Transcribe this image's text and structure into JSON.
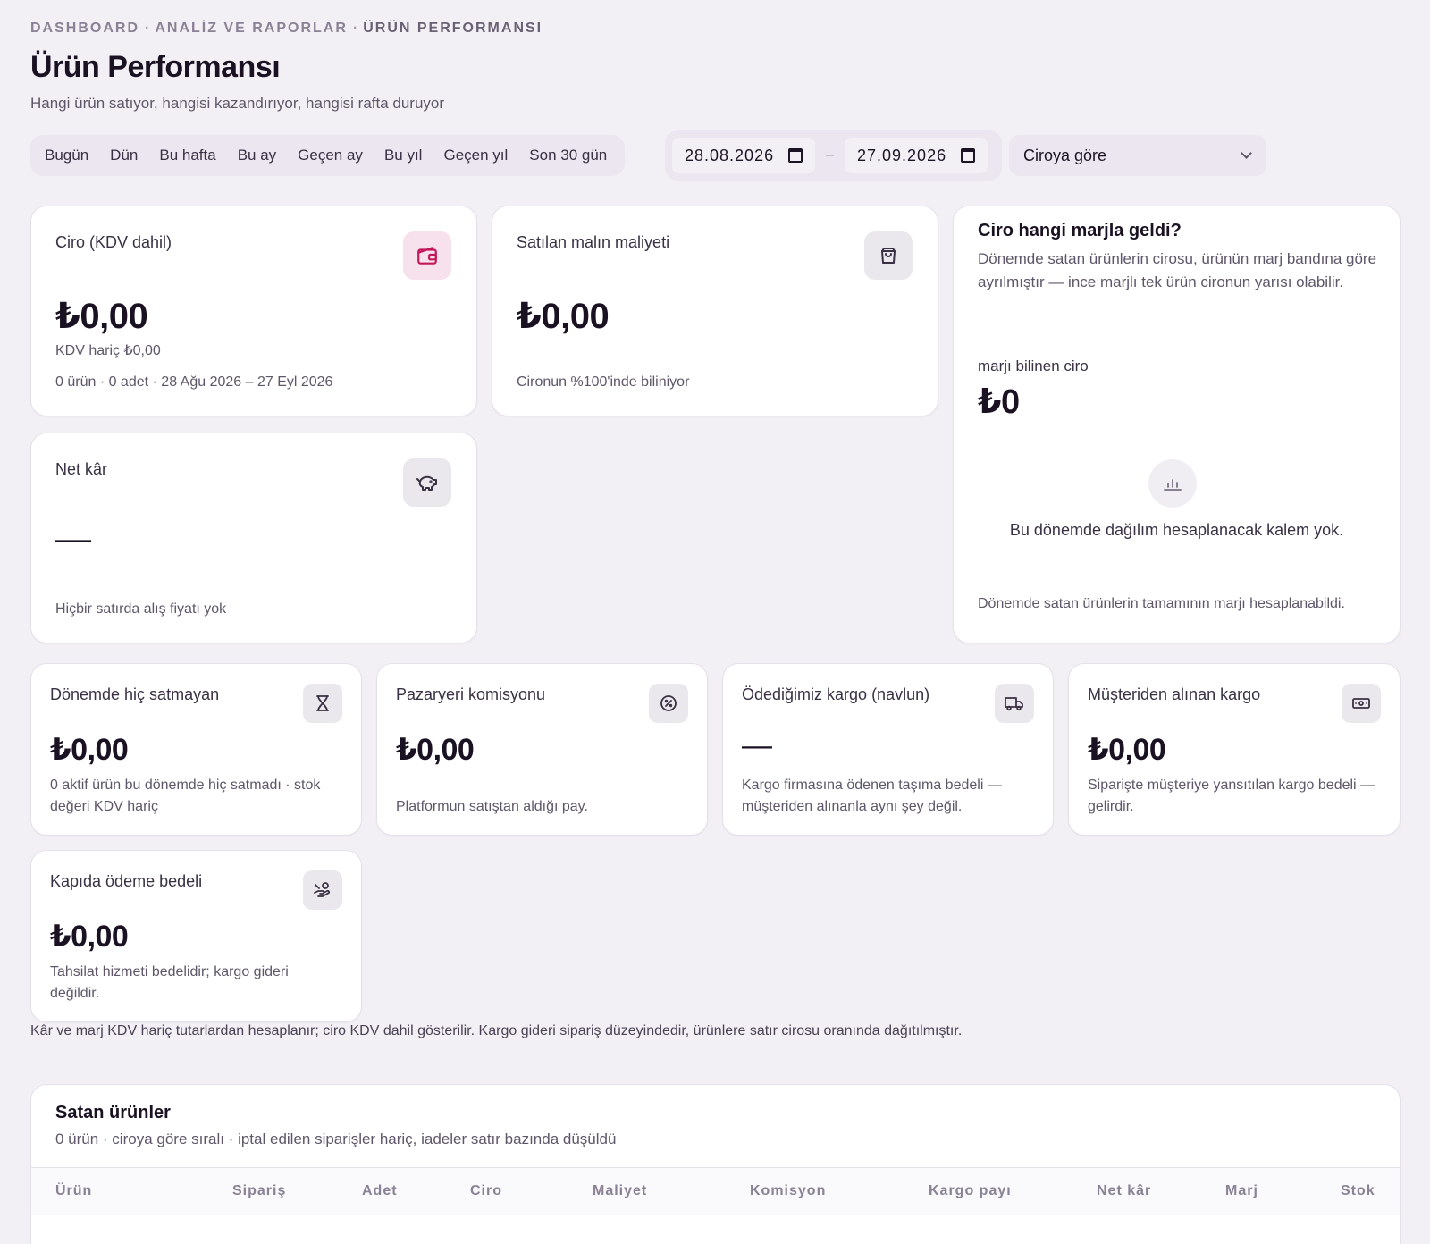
{
  "breadcrumb": {
    "root": "DASHBOARD",
    "mid": "ANALİZ VE RAPORLAR",
    "current": "ÜRÜN PERFORMANSI",
    "sep": "·"
  },
  "header": {
    "title": "Ürün Performansı",
    "subtitle": "Hangi ürün satıyor, hangisi kazandırıyor, hangisi rafta duruyor"
  },
  "filters": {
    "presets": [
      "Bugün",
      "Dün",
      "Bu hafta",
      "Bu ay",
      "Geçen ay",
      "Bu yıl",
      "Geçen yıl",
      "Son 30 gün"
    ],
    "date_from": "28.08.2026",
    "date_to": "27.09.2026",
    "date_sep": "–",
    "sort": "Ciroya göre"
  },
  "cards": {
    "ciro": {
      "label": "Ciro (KDV dahil)",
      "value": "₺0,00",
      "sub1": "KDV hariç ₺0,00",
      "sub2": "0 ürün · 0 adet · 28 Ağu 2026 – 27 Eyl 2026"
    },
    "smm": {
      "label": "Satılan malın maliyeti",
      "value": "₺0,00",
      "sub": "Cironun %100'inde biliniyor"
    },
    "net": {
      "label": "Net kâr",
      "value": "—",
      "sub": "Hiçbir satırda alış fiyatı yok"
    },
    "margin": {
      "title": "Ciro hangi marjla geldi?",
      "desc": "Dönemde satan ürünlerin cirosu, ürünün marj bandına göre ayrılmıştır — ince marjlı tek ürün cironun yarısı olabilir.",
      "known_label": "marjı bilinen ciro",
      "known_value": "₺0",
      "empty": "Bu dönemde dağılım hesaplanacak kalem yok.",
      "footer": "Dönemde satan ürünlerin tamamının marjı hesaplanabildi."
    },
    "unsold": {
      "label": "Dönemde hiç satmayan",
      "value": "₺0,00",
      "sub": "0 aktif ürün bu dönemde hiç satmadı · stok değeri KDV hariç"
    },
    "commission": {
      "label": "Pazaryeri komisyonu",
      "value": "₺0,00",
      "sub": "Platformun satıştan aldığı pay."
    },
    "shipping_paid": {
      "label": "Ödediğimiz kargo (navlun)",
      "value": "—",
      "sub": "Kargo firmasına ödenen taşıma bedeli — müşteriden alınanla aynı şey değil."
    },
    "shipping_recv": {
      "label": "Müşteriden alınan kargo",
      "value": "₺0,00",
      "sub": "Siparişte müşteriye yansıtılan kargo bedeli — gelirdir."
    },
    "cod": {
      "label": "Kapıda ödeme bedeli",
      "value": "₺0,00",
      "sub": "Tahsilat hizmeti bedelidir; kargo gideri değildir."
    }
  },
  "note": "Kâr ve marj KDV hariç tutarlardan hesaplanır; ciro KDV dahil gösterilir. Kargo gideri sipariş düzeyindedir, ürünlere satır cirosu oranında dağıtılmıştır.",
  "table": {
    "title": "Satan ürünler",
    "subtitle": "0 ürün · ciroya göre sıralı · iptal edilen siparişler hariç, iadeler satır bazında düşüldü",
    "columns": [
      "Ürün",
      "Sipariş",
      "Adet",
      "Ciro",
      "Maliyet",
      "Komisyon",
      "Kargo payı",
      "Net kâr",
      "Marj",
      "Stok"
    ]
  },
  "colors": {
    "background": "#f3f0f5",
    "accent": "#c2185b",
    "card": "#ffffff",
    "muted": "#5f5769"
  }
}
